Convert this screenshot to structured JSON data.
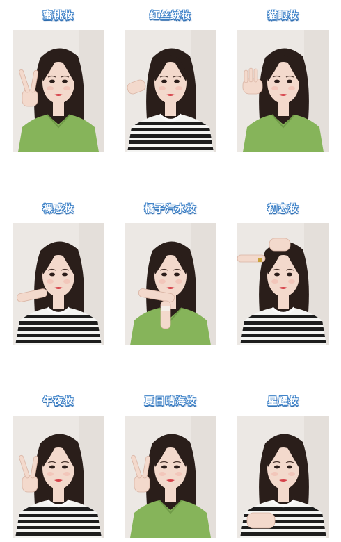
{
  "looks": [
    {
      "label": "蜜桃妆",
      "outfit": "green-knit",
      "hand": "peace-sign"
    },
    {
      "label": "红丝绒妆",
      "outfit": "striped",
      "hand": "side-wave"
    },
    {
      "label": "猫眼妆",
      "outfit": "green-knit",
      "hand": "open-hand"
    },
    {
      "label": "裸感妆",
      "outfit": "striped",
      "hand": "chin-touch"
    },
    {
      "label": "橘子汽水妆",
      "outfit": "green-knit",
      "hand": "chin-rest"
    },
    {
      "label": "初恋妆",
      "outfit": "striped",
      "hand": "head-touch"
    },
    {
      "label": "午夜妆",
      "outfit": "striped",
      "hand": "peace-sign"
    },
    {
      "label": "夏日晴海妆",
      "outfit": "green-knit",
      "hand": "peace-sign"
    },
    {
      "label": "星耀妆",
      "outfit": "striped",
      "hand": "hand-on-chest"
    }
  ],
  "colors": {
    "title_fill": "#ffffff",
    "title_outline": "#3f83c9",
    "photo_background": "#ece8e4",
    "green_knit": "#86b45a",
    "stripe_dark": "#1d1d1d",
    "stripe_light": "#f4f4f2",
    "hair": "#2a1e1a",
    "skin": "#f3d9cc",
    "lips": "#d6424a"
  }
}
